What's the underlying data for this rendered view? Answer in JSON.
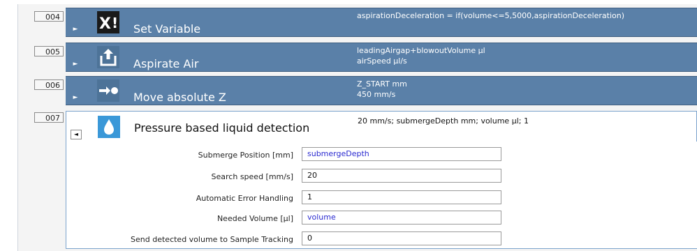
{
  "steps": [
    {
      "num": "004",
      "title": "Set Variable",
      "icon": "set-variable-icon",
      "detail_lines": [
        "aspirationDeceleration = if(volume<=5,5000,aspirationDeceleration)"
      ],
      "expanded": false
    },
    {
      "num": "005",
      "title": "Aspirate Air",
      "icon": "aspirate-upload-icon",
      "detail_lines": [
        "leadingAirgap+blowoutVolume µl",
        "airSpeed µl/s"
      ],
      "expanded": false
    },
    {
      "num": "006",
      "title": "Move absolute Z",
      "icon": "move-arrow-icon",
      "detail_lines": [
        "Z_START mm",
        "450 mm/s"
      ],
      "expanded": false
    },
    {
      "num": "007",
      "title": "Pressure based liquid detection",
      "icon": "droplet-icon",
      "detail_lines": [
        "20 mm/s; submergeDepth mm; volume µl; 1"
      ],
      "expanded": true
    }
  ],
  "expander_collapsed": "►",
  "expander_expanded": "◄",
  "params": [
    {
      "label": "Submerge Position [mm]",
      "value": "submergeDepth",
      "is_variable": true
    },
    {
      "label": "Search speed [mm/s]",
      "value": "20",
      "is_variable": false
    },
    {
      "label": "Automatic Error Handling",
      "value": "1",
      "is_variable": false
    },
    {
      "label": "Needed Volume [µl]",
      "value": "volume",
      "is_variable": true
    },
    {
      "label": "Send detected volume to Sample Tracking",
      "value": "0",
      "is_variable": false
    }
  ],
  "colors": {
    "row_bg": "#5a80a8",
    "variable_text": "#2a2ad0",
    "droplet": "#3a98d8"
  }
}
